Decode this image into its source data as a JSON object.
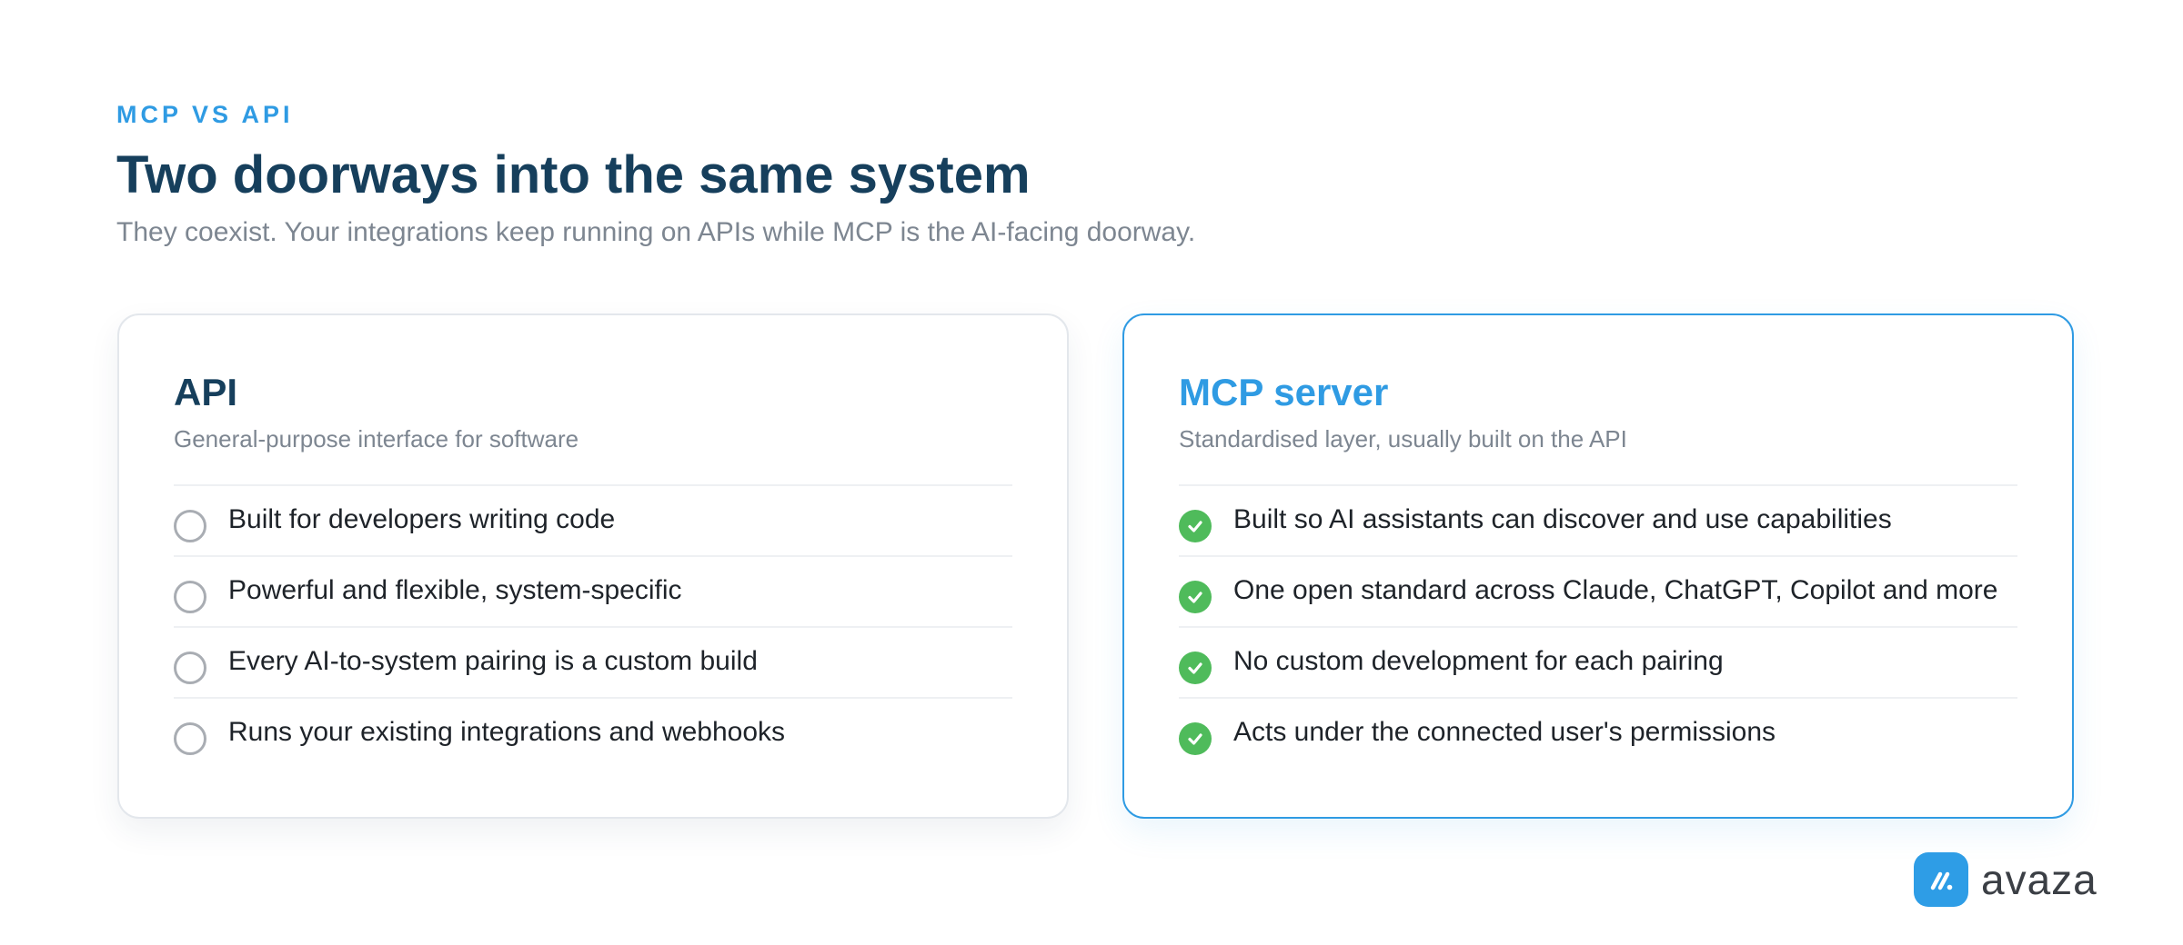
{
  "header": {
    "eyebrow": "MCP VS API",
    "title": "Two doorways into the same system",
    "subtitle": "They coexist. Your integrations keep running on APIs while MCP is the AI-facing doorway."
  },
  "cards": {
    "api": {
      "title": "API",
      "subtitle": "General-purpose interface for software",
      "items": [
        "Built for developers writing code",
        "Powerful and flexible, system-specific",
        "Every AI-to-system pairing is a custom build",
        "Runs your existing integrations and webhooks"
      ],
      "icon": "empty-circle-icon"
    },
    "mcp": {
      "title": "MCP server",
      "subtitle": "Standardised layer, usually built on the API",
      "items": [
        "Built so AI assistants can discover and use capabilities",
        "One open standard across Claude, ChatGPT, Copilot and more",
        "No custom development for each pairing",
        "Acts under the connected user's permissions"
      ],
      "icon": "check-circle-icon"
    }
  },
  "brand": {
    "name": "avaza",
    "logo_icon": "avaza-logo-icon"
  },
  "colors": {
    "accent": "#2f9be3",
    "title": "#163f5c",
    "muted": "#7d8691",
    "check": "#4fbb5b",
    "circle": "#a9adb3"
  }
}
